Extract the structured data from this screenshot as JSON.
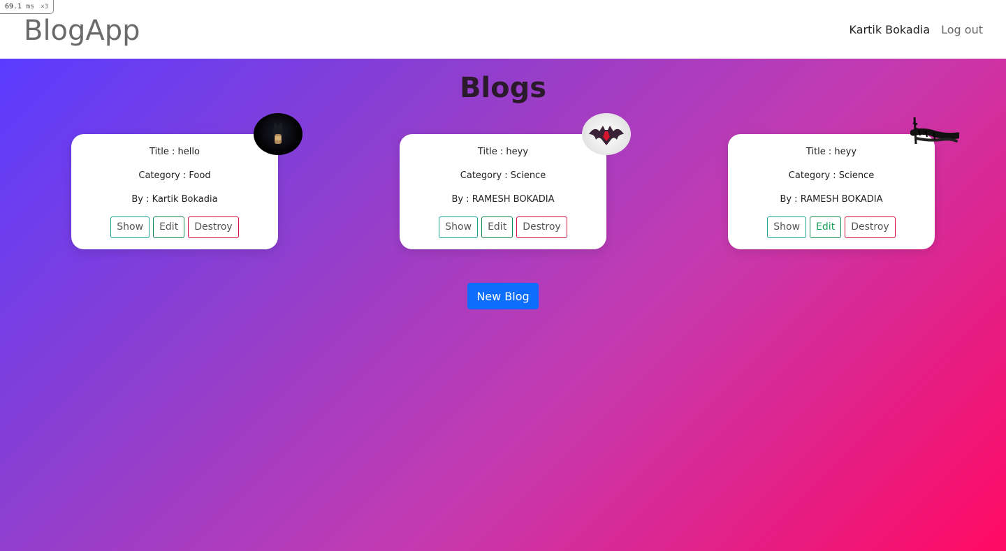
{
  "perf": {
    "value": "69.1",
    "unit": "ms",
    "multiplier": "×3"
  },
  "navbar": {
    "brand": "BlogApp",
    "user": "Kartik Bokadia",
    "logout": "Log out"
  },
  "page": {
    "title": "Blogs"
  },
  "blogs": [
    {
      "title_line": "Title : hello",
      "category_line": "Category : Food",
      "author_line": "By : Kartik Bokadia",
      "avatar": "dark-hero-icon"
    },
    {
      "title_line": "Title : heyy",
      "category_line": "Category : Science",
      "author_line": "By : RAMESH BOKADIA",
      "avatar": "bat-logo-icon"
    },
    {
      "title_line": "Title : heyy",
      "category_line": "Category : Science",
      "author_line": "By : RAMESH BOKADIA",
      "avatar": "ink-scribble-icon"
    }
  ],
  "actions": {
    "show": "Show",
    "edit": "Edit",
    "destroy": "Destroy"
  },
  "new_blog": "New Blog",
  "colors": {
    "primary": "#0d6efd",
    "show_border": "#1aa39a",
    "edit_border": "#198754",
    "destroy_border": "#d11141",
    "gradient_start": "#5a3cff",
    "gradient_end": "#ff0a63"
  }
}
